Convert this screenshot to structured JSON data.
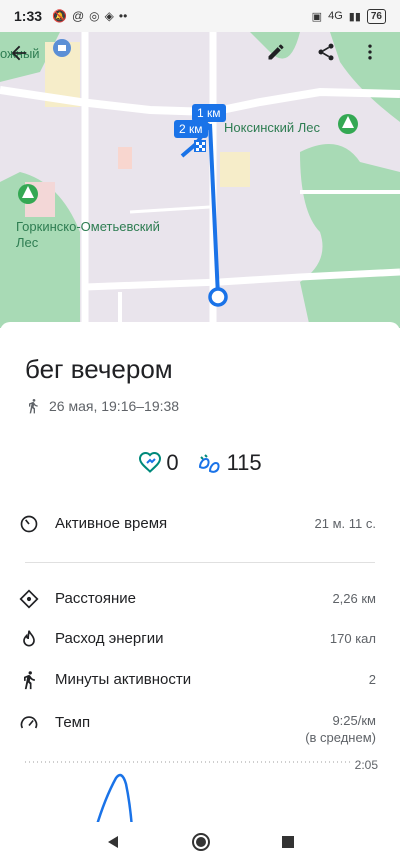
{
  "status_bar": {
    "time": "1:33",
    "network": "4G",
    "battery": "76"
  },
  "map": {
    "labels": {
      "partial_street": "ожный",
      "forest_right": "Ноксинский Лес",
      "forest_left_line1": "Горкинско-Ометьевский",
      "forest_left_line2": "Лес"
    },
    "markers": {
      "km1": "1 км",
      "km2": "2 км"
    },
    "icons": {
      "back": "arrow-left-icon",
      "edit": "pencil-icon",
      "share": "share-icon",
      "more": "more-vert-icon"
    },
    "route_color": "#1a73e8"
  },
  "activity": {
    "title": "бег вечером",
    "date_time": "26 мая, 19:16–19:38",
    "heart_points": "0",
    "steps": "115"
  },
  "stats": {
    "active_time": {
      "label": "Активное время",
      "value": "21 м. 11 с."
    },
    "distance": {
      "label": "Расстояние",
      "value": "2,26 км"
    },
    "energy": {
      "label": "Расход энергии",
      "value": "170 кал"
    },
    "move_minutes": {
      "label": "Минуты активности",
      "value": "2"
    },
    "pace": {
      "label": "Темп",
      "value": "9:25/км",
      "value_note": "(в среднем)"
    }
  },
  "pace_chart": {
    "tick_label": "2:05"
  },
  "colors": {
    "accent_teal": "#00897b",
    "accent_blue": "#1a73e8",
    "forest": "#a8dab5"
  }
}
